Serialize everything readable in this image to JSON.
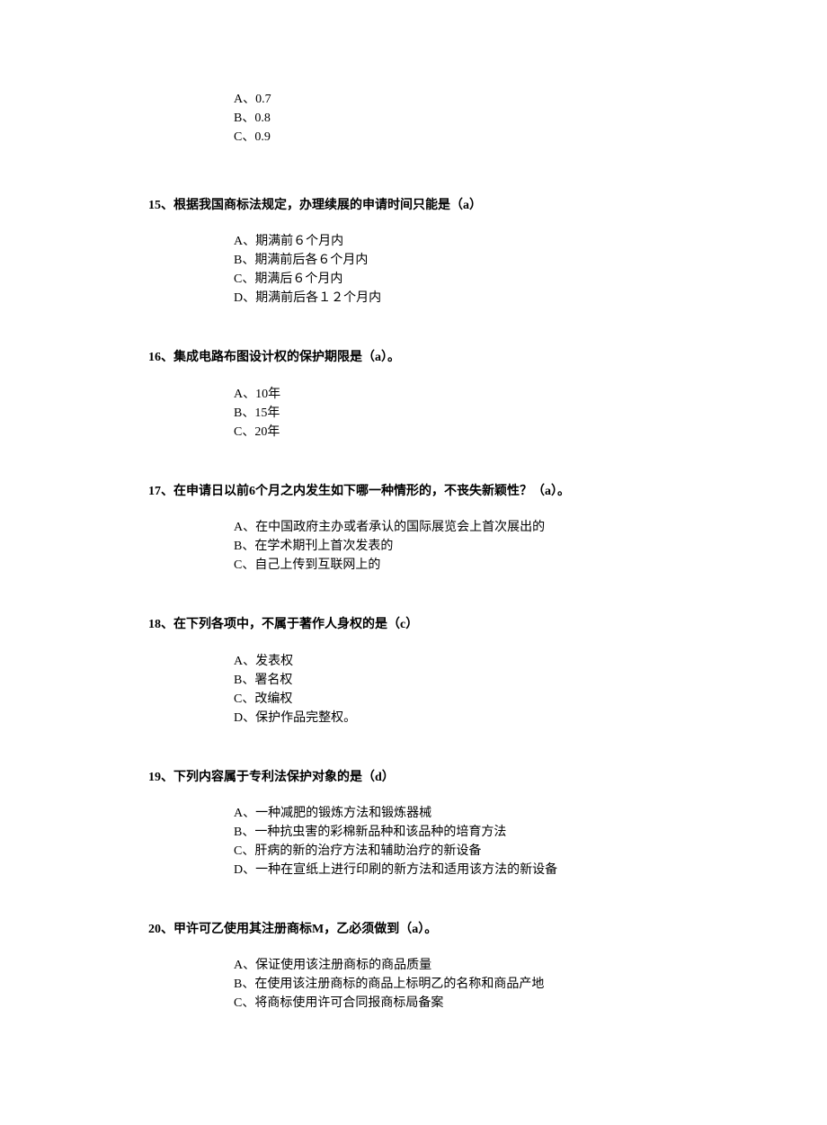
{
  "orphan_options": [
    "A、0.7",
    "B、0.8",
    "C、0.9"
  ],
  "questions": [
    {
      "number": "15",
      "text": "根据我国商标法规定，办理续展的申请时间只能是（a）",
      "options": [
        "A、期满前６个月内",
        "B、期满前后各６个月内",
        "C、期满后６个月内",
        "D、期满前后各１２个月内"
      ]
    },
    {
      "number": "16",
      "text": "集成电路布图设计权的保护期限是（a）。",
      "options": [
        "A、10年",
        "B、15年",
        "C、20年"
      ]
    },
    {
      "number": "17",
      "text": "在申请日以前6个月之内发生如下哪一种情形的，不丧失新颖性？（a）。",
      "options": [
        "A、在中国政府主办或者承认的国际展览会上首次展出的",
        "B、在学术期刊上首次发表的",
        "C、自己上传到互联网上的"
      ]
    },
    {
      "number": "18",
      "text": "在下列各项中，不属于著作人身权的是（c）",
      "options": [
        "A、发表权",
        "B、署名权",
        "C、改编权",
        "D、保护作品完整权。"
      ]
    },
    {
      "number": "19",
      "text": "下列内容属于专利法保护对象的是（d）",
      "options": [
        "A、一种减肥的锻炼方法和锻炼器械",
        "B、一种抗虫害的彩棉新品种和该品种的培育方法",
        "C、肝病的新的治疗方法和辅助治疗的新设备",
        "D、一种在宣纸上进行印刷的新方法和适用该方法的新设备"
      ]
    },
    {
      "number": "20",
      "text": "甲许可乙使用其注册商标M，乙必须做到（a）。",
      "options": [
        "A、保证使用该注册商标的商品质量",
        "B、在使用该注册商标的商品上标明乙的名称和商品产地",
        "C、将商标使用许可合同报商标局备案"
      ]
    }
  ]
}
